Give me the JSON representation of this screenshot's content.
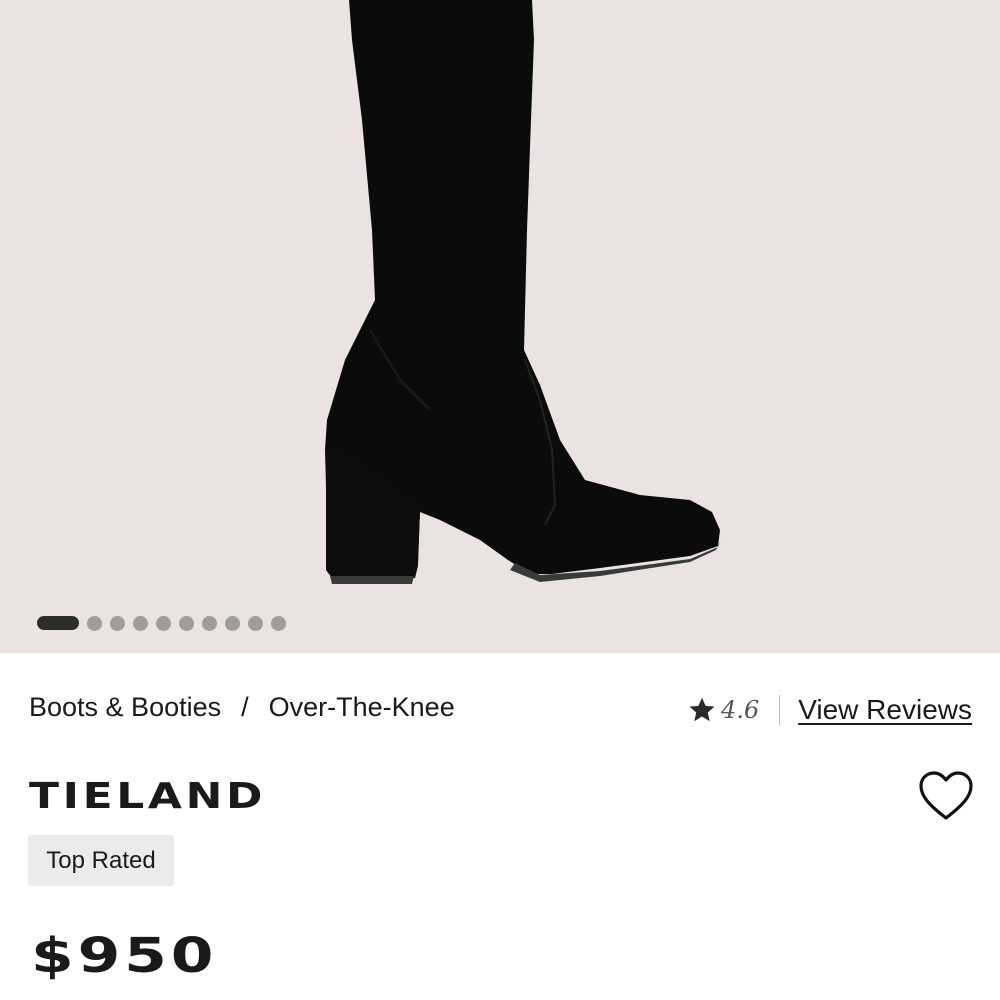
{
  "gallery": {
    "image_alt": "Black suede over-the-knee boot with block heel",
    "dot_count": 10,
    "active_index": 0
  },
  "breadcrumb": {
    "items": [
      "Boots & Booties",
      "Over-The-Knee"
    ],
    "separator": "/"
  },
  "rating": {
    "icon": "star-icon",
    "value": "4.6",
    "reviews_link": "View Reviews"
  },
  "product": {
    "name": "TIELAND",
    "badge": "Top Rated",
    "price": "$950",
    "wishlist_icon": "heart-outline-icon"
  },
  "colors": {
    "hero_bg": "#ebe3e1",
    "boot": "#0a0a0a",
    "active_dot": "#2e2c2b",
    "inactive_dot": "#a09c9a",
    "badge_bg": "#ebebeb"
  }
}
